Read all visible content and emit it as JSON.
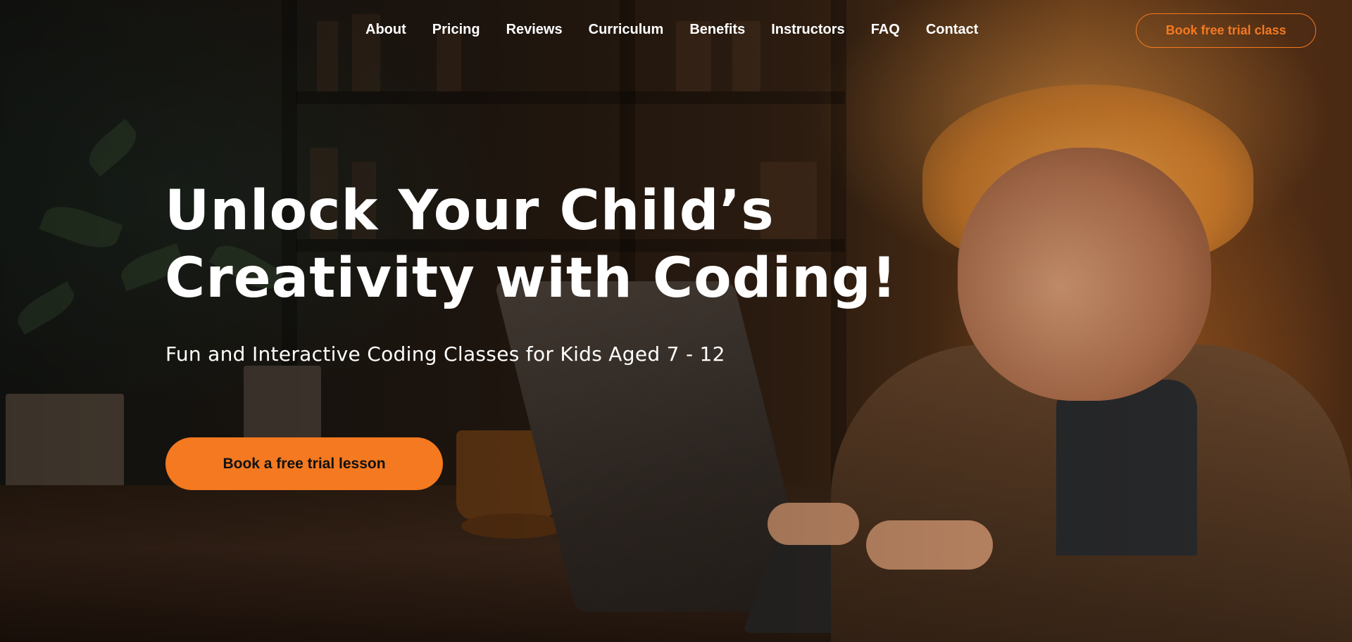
{
  "nav": {
    "links": [
      "About",
      "Pricing",
      "Reviews",
      "Curriculum",
      "Benefits",
      "Instructors",
      "FAQ",
      "Contact"
    ],
    "cta_label": "Book free trial class"
  },
  "hero": {
    "title": "Unlock Your Child’s Creativity with Coding!",
    "subtitle": "Fun and Interactive Coding Classes for Kids Aged 7 - 12",
    "cta_label": "Book a free trial lesson"
  },
  "colors": {
    "accent": "#f47920",
    "text": "#ffffff"
  }
}
